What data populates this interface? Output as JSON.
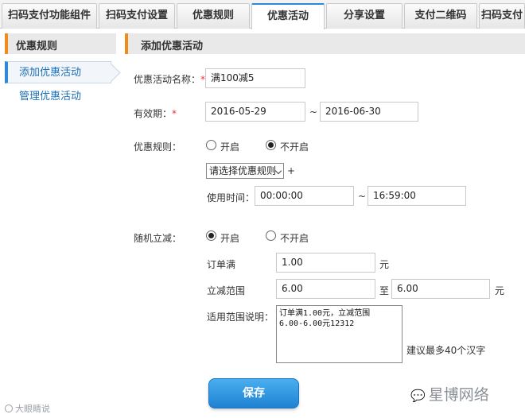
{
  "tabs": [
    {
      "label": "扫码支付功能组件",
      "active": false
    },
    {
      "label": "扫码支付设置",
      "active": false
    },
    {
      "label": "优惠规则",
      "active": false
    },
    {
      "label": "优惠活动",
      "active": true
    },
    {
      "label": "分享设置",
      "active": false
    },
    {
      "label": "支付二维码",
      "active": false
    },
    {
      "label": "扫码支付",
      "active": false
    }
  ],
  "sidebar": {
    "header": "优惠规则",
    "items": [
      {
        "label": "添加优惠活动",
        "active": true
      },
      {
        "label": "管理优惠活动",
        "active": false
      }
    ]
  },
  "main": {
    "header": "添加优惠活动",
    "required_mark": "*",
    "name": {
      "label": "优惠活动名称：",
      "value": "满100减5"
    },
    "validity": {
      "label": "有效期：",
      "start": "2016-05-29",
      "separator": "~",
      "end": "2016-06-30"
    },
    "rule": {
      "label": "优惠规则：",
      "on_label": "开启",
      "off_label": "不开启",
      "selected": "off",
      "select_value": "请选择优惠规则",
      "plus": "+",
      "time_label": "使用时间：",
      "time_start": "00:00:00",
      "time_separator": "~",
      "time_end": "16:59:00"
    },
    "random": {
      "label": "随机立减：",
      "on_label": "开启",
      "off_label": "不开启",
      "selected": "on",
      "order_label": "订单满",
      "order_value": "1.00",
      "order_unit": "元",
      "range_label": "立减范围",
      "range_min": "6.00",
      "range_to": "至",
      "range_max": "6.00",
      "range_unit": "元",
      "desc_label": "适用范围说明：",
      "desc_line1": "订单满1.00元，立减范围",
      "desc_line2": "6.00-6.00元12312",
      "desc_hint": "建议最多40个汉字"
    },
    "save_label": "保存"
  },
  "watermarks": {
    "left": "大眼睛说",
    "right": "星博网络"
  },
  "colors": {
    "accent": "#2e8ad8",
    "header_bar": "#f08c1b",
    "link": "#1b6fb5",
    "required": "#e33333"
  }
}
